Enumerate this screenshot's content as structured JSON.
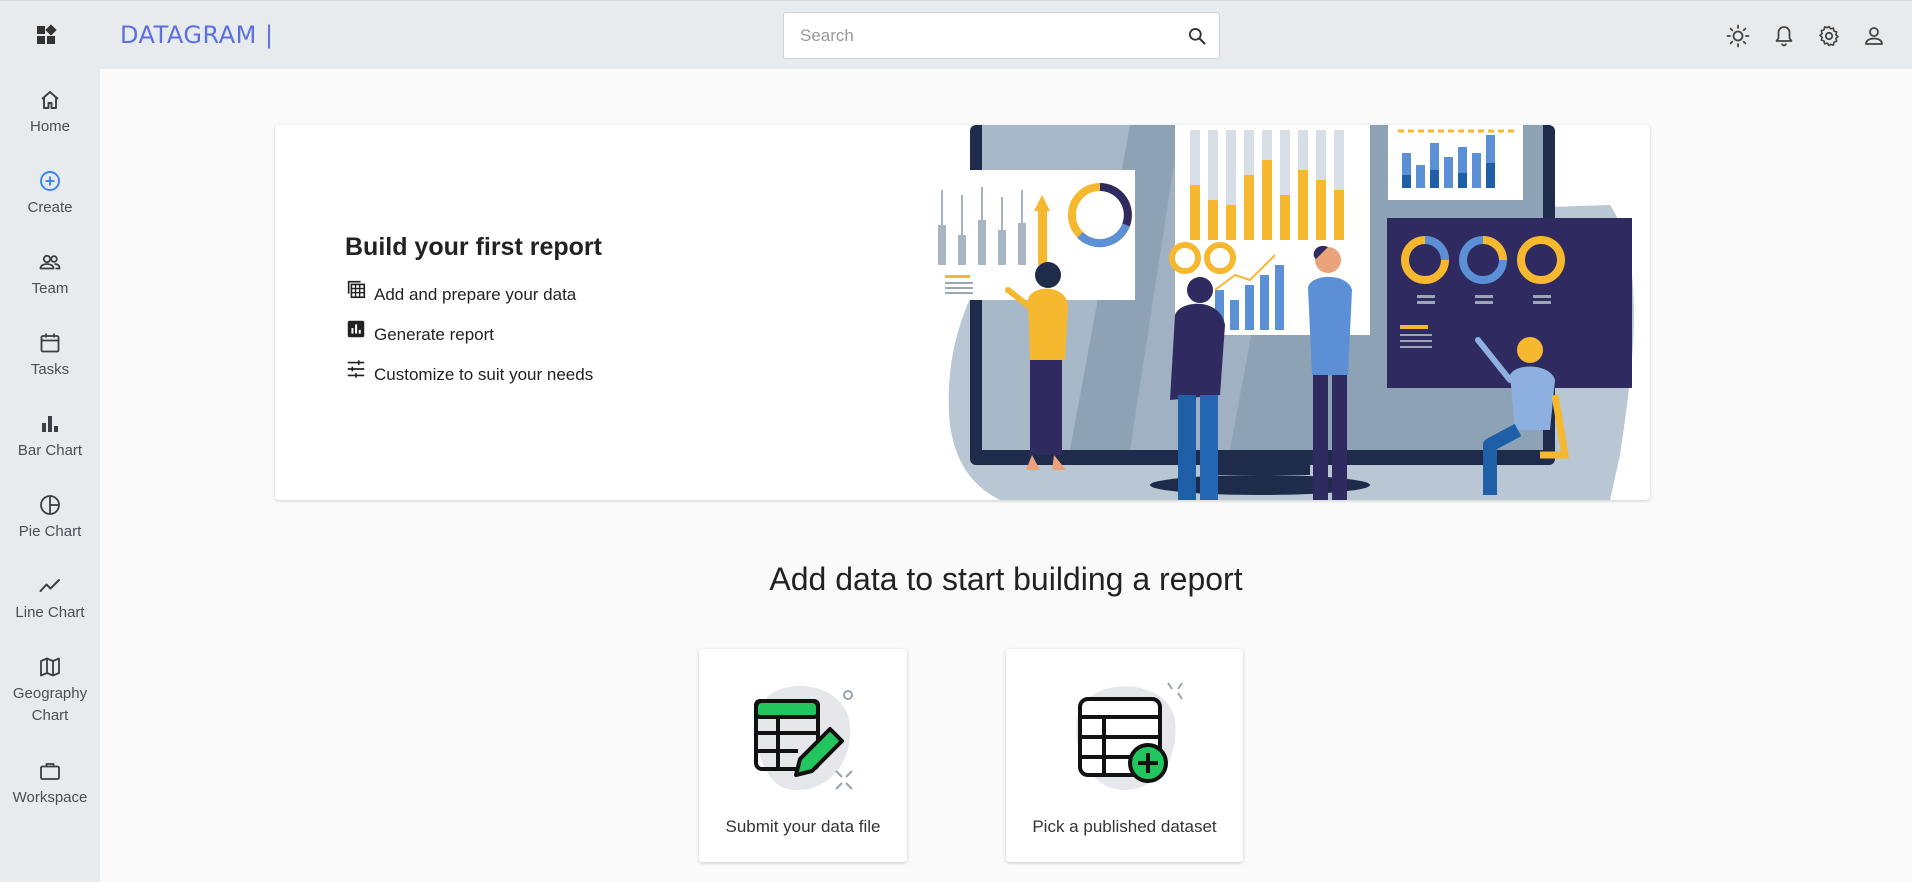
{
  "header": {
    "brand": "DATAGRAM |",
    "search": {
      "placeholder": "Search",
      "value": ""
    },
    "icons": [
      "theme-toggle-icon",
      "notifications-icon",
      "settings-icon",
      "account-icon"
    ]
  },
  "sidebar": {
    "items": [
      {
        "label": "Home",
        "icon": "home-icon"
      },
      {
        "label": "Create",
        "icon": "add-circle-icon"
      },
      {
        "label": "Team",
        "icon": "people-icon"
      },
      {
        "label": "Tasks",
        "icon": "calendar-icon"
      },
      {
        "label": "Bar Chart",
        "icon": "bar-chart-icon"
      },
      {
        "label": "Pie Chart",
        "icon": "pie-chart-icon"
      },
      {
        "label": "Line Chart",
        "icon": "line-chart-icon"
      },
      {
        "label": "Geography\nChart",
        "icon": "map-icon"
      },
      {
        "label": "Workspace",
        "icon": "briefcase-icon"
      }
    ]
  },
  "hero": {
    "title": "Build your first report",
    "steps": [
      {
        "label": "Add and prepare your data",
        "icon": "table-stack-icon"
      },
      {
        "label": "Generate report",
        "icon": "report-chart-icon"
      },
      {
        "label": "Customize to suit your needs",
        "icon": "tune-icon"
      }
    ]
  },
  "main": {
    "section_title": "Add data to start building a report",
    "cards": [
      {
        "label": "Submit your data file",
        "icon": "table-edit-icon"
      },
      {
        "label": "Pick a published dataset",
        "icon": "table-add-icon"
      }
    ]
  },
  "colors": {
    "accent": "#5b6fe0",
    "active_icon": "#3b82f6",
    "sidebar_bg": "#e8ebee",
    "illustration_navy": "#2f2a5f",
    "illustration_yellow": "#f5b82e",
    "illustration_blue": "#5b8fd6",
    "card_green": "#22c55e"
  }
}
